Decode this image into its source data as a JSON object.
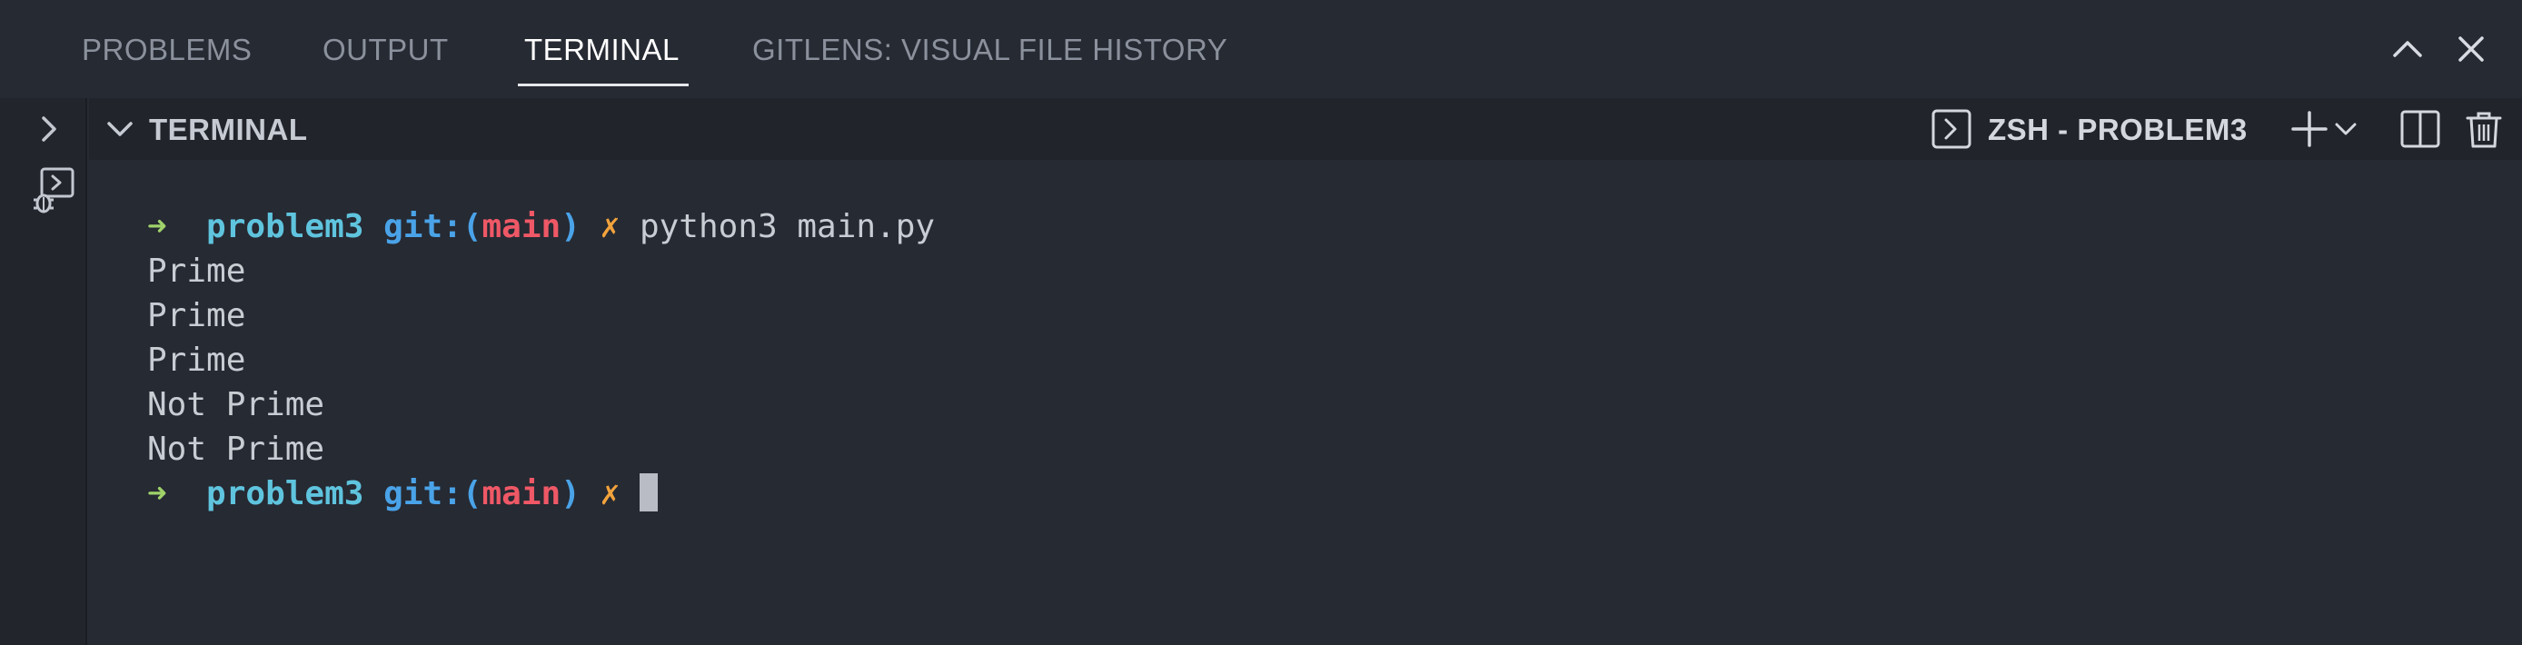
{
  "panel": {
    "tabs": [
      {
        "label": "PROBLEMS",
        "active": false
      },
      {
        "label": "OUTPUT",
        "active": false
      },
      {
        "label": "TERMINAL",
        "active": true
      },
      {
        "label": "GITLENS: VISUAL FILE HISTORY",
        "active": false
      }
    ],
    "actions": {
      "maximize_icon": "chevron-up-icon",
      "close_icon": "close-icon"
    }
  },
  "left_strip": {
    "icons": [
      "chevron-right-icon",
      "debug-console-icon"
    ]
  },
  "terminal": {
    "section_title": "TERMINAL",
    "shell_name": "ZSH - PROBLEM3",
    "header_icons": [
      "terminal-icon",
      "plus-icon",
      "chevron-down-icon",
      "split-icon",
      "trash-icon"
    ],
    "prompt": {
      "arrow": "➜",
      "dir": "problem3",
      "git_prefix": "git:(",
      "branch": "main",
      "git_suffix": ")",
      "dirty": "✗"
    },
    "command": "python3 main.py",
    "output": [
      "Prime",
      "Prime",
      "Prime",
      "Not Prime",
      "Not Prime"
    ]
  },
  "colors": {
    "background": "#262a33",
    "arrow": "#9fd36a",
    "dir": "#5fc4de",
    "git": "#4aa3e8",
    "branch": "#ef5866",
    "dirty": "#f2a33c"
  }
}
